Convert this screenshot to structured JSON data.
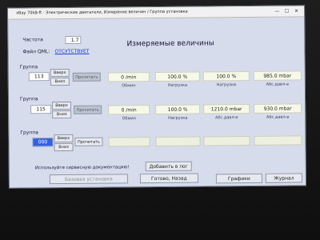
{
  "window": {
    "title": "xBay 70kB-ft · Электрические двигатели, Измерение величин / Группа установка",
    "minimize_glyph": "—",
    "maximize_glyph": "☐",
    "close_glyph": "✕"
  },
  "header": {
    "frequency_label": "Частота",
    "frequency_value": "1.7",
    "file_label": "Файл QML:",
    "file_value": "ОТСУТСТВУЕТ",
    "title": "Измеряемые величины"
  },
  "groups": [
    {
      "label": "Группа",
      "number": "113",
      "up_label": "Вверх",
      "down_label": "Вниз",
      "read_label": "Прочитать",
      "values": [
        {
          "value": "0 /min",
          "caption": "Обмин"
        },
        {
          "value": "100.0 %",
          "caption": "Нагрузка"
        },
        {
          "value": "100.0 %",
          "caption": "Нагрузка"
        },
        {
          "value": "985.0 mbar",
          "caption": "Абс.давл-е"
        }
      ]
    },
    {
      "label": "Группа",
      "number": "115",
      "up_label": "Вверх",
      "down_label": "Вниз",
      "read_label": "Прочитать",
      "values": [
        {
          "value": "0 /min",
          "caption": "Обмин"
        },
        {
          "value": "100.0 %",
          "caption": "Нагрузка"
        },
        {
          "value": "1210.0 mbar",
          "caption": "Абс.давл-е"
        },
        {
          "value": "930.0 mbar",
          "caption": "Абс.давл-е"
        }
      ]
    },
    {
      "label": "Группа",
      "number": "000",
      "up_label": "Вверх",
      "down_label": "Вниз",
      "read_label": "Прочитать",
      "values": [
        {
          "value": "",
          "caption": ""
        },
        {
          "value": "",
          "caption": ""
        },
        {
          "value": "",
          "caption": ""
        },
        {
          "value": "",
          "caption": ""
        }
      ]
    }
  ],
  "footer": {
    "hint": "Используйте сервисную документацию!",
    "add_to_log": "Добавить в лог",
    "basic_settings": "Базовая установка",
    "done_back": "Готово, Назад",
    "graphs": "Графики",
    "journal": "Журнал"
  }
}
